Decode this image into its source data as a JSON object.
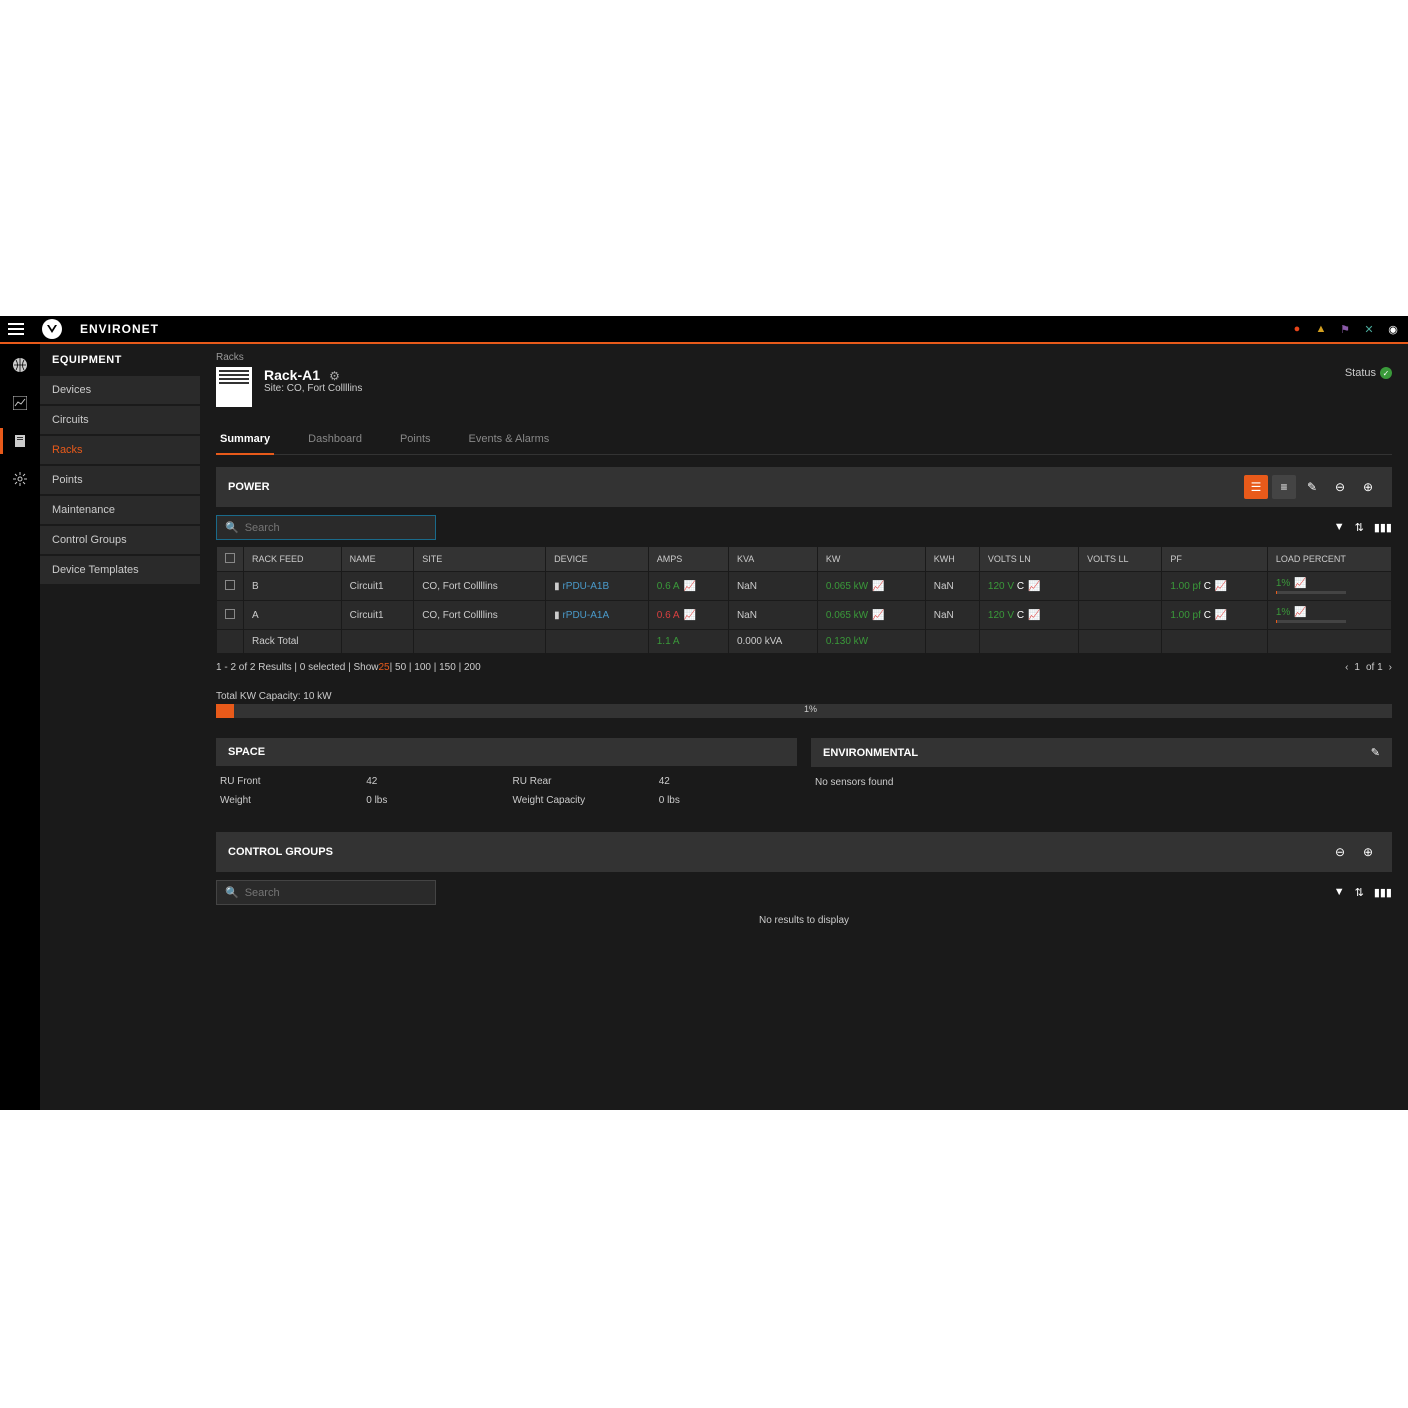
{
  "brand": "ENVIRONET",
  "sidebar": {
    "title": "EQUIPMENT",
    "items": [
      "Devices",
      "Circuits",
      "Racks",
      "Points",
      "Maintenance",
      "Control Groups",
      "Device Templates"
    ]
  },
  "crumb": "Racks",
  "rack": {
    "title": "Rack-A1",
    "subtitle": "Site: CO, Fort Collllins",
    "status": "Status"
  },
  "tabs": [
    "Summary",
    "Dashboard",
    "Points",
    "Events & Alarms"
  ],
  "power": {
    "title": "POWER",
    "search_placeholder": "Search",
    "headers": [
      "RACK FEED",
      "NAME",
      "SITE",
      "DEVICE",
      "AMPS",
      "KVA",
      "KW",
      "KWH",
      "VOLTS LN",
      "VOLTS LL",
      "PF",
      "LOAD PERCENT"
    ],
    "rows": [
      {
        "feed": "B",
        "name": "Circuit1",
        "site": "CO, Fort Collllins",
        "device": "rPDU-A1B",
        "amps": "0.6 A",
        "amps_color": "green",
        "kva": "NaN",
        "kw": "0.065 kW",
        "kwh": "NaN",
        "vln": "120 V",
        "vll": "",
        "pf": "1.00 pf",
        "load": "1%"
      },
      {
        "feed": "A",
        "name": "Circuit1",
        "site": "CO, Fort Collllins",
        "device": "rPDU-A1A",
        "amps": "0.6 A",
        "amps_color": "red",
        "kva": "NaN",
        "kw": "0.065 kW",
        "kwh": "NaN",
        "vln": "120 V",
        "vll": "",
        "pf": "1.00 pf",
        "load": "1%"
      }
    ],
    "total": {
      "label": "Rack Total",
      "amps": "1.1 A",
      "kva": "0.000 kVA",
      "kw": "0.130 kW"
    },
    "pager_left": "1 - 2 of 2 Results | 0 selected | Show ",
    "pager_sizes": "25",
    "pager_rest": " | 50 | 100 | 150 | 200",
    "page_num": "1",
    "page_of": "of 1"
  },
  "capacity": {
    "label": "Total KW Capacity: 10 kW",
    "percent": "1%"
  },
  "space": {
    "title": "SPACE",
    "ru_front_label": "RU Front",
    "ru_front": "42",
    "ru_rear_label": "RU Rear",
    "ru_rear": "42",
    "weight_label": "Weight",
    "weight": "0 lbs",
    "wcap_label": "Weight Capacity",
    "wcap": "0 lbs"
  },
  "env": {
    "title": "ENVIRONMENTAL",
    "none": "No sensors found"
  },
  "cg": {
    "title": "CONTROL GROUPS",
    "search_placeholder": "Search",
    "none": "No results to display"
  }
}
